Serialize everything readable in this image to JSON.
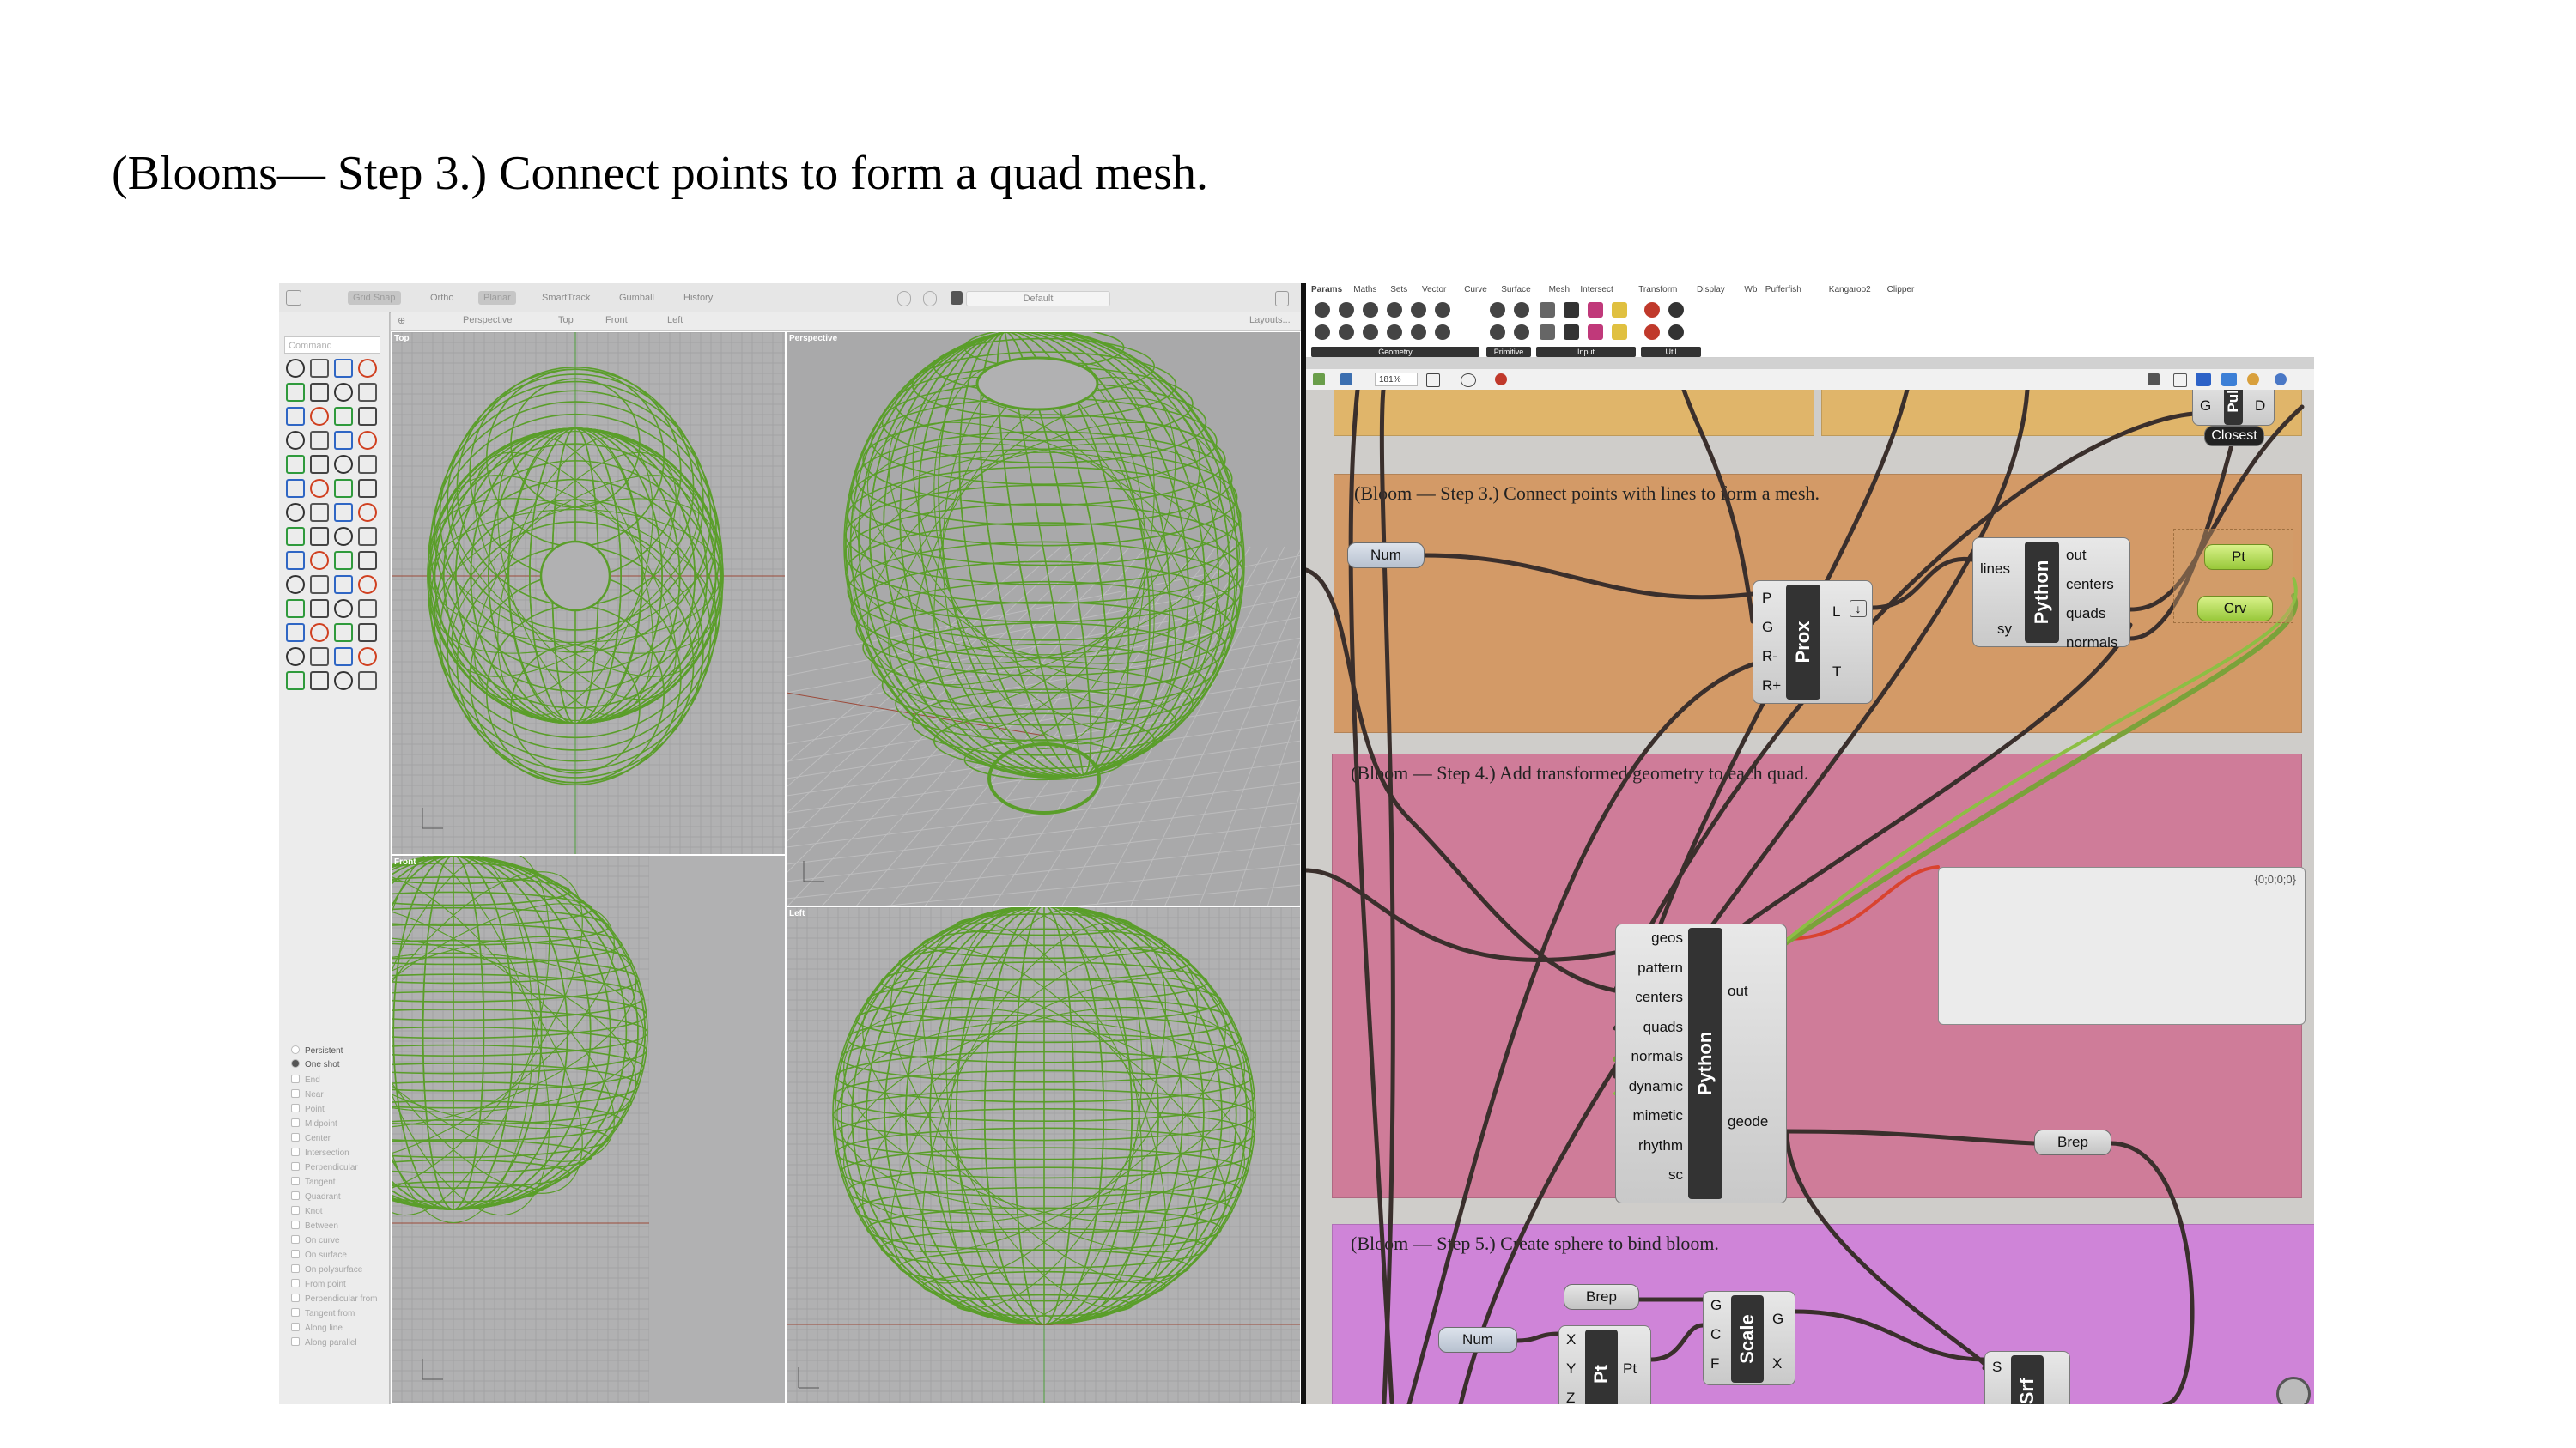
{
  "slide": {
    "title": "(Blooms— Step 3.) Connect points to form a quad mesh."
  },
  "rhino": {
    "toolbar": [
      "Grid Snap",
      "Ortho",
      "Planar",
      "SmartTrack",
      "Gumball",
      "History"
    ],
    "toolbar_right": "Default",
    "view_tabs": [
      "Perspective",
      "Top",
      "Front",
      "Left"
    ],
    "layouts_label": "Layouts...",
    "command_placeholder": "Command",
    "viewports": {
      "top": "Top",
      "perspective": "Perspective",
      "front": "Front",
      "left": "Left"
    },
    "osnap_modes": {
      "persistent": "Persistent",
      "one_shot": "One shot"
    },
    "osnaps": [
      "End",
      "Near",
      "Point",
      "Midpoint",
      "Center",
      "Intersection",
      "Perpendicular",
      "Tangent",
      "Quadrant",
      "Knot",
      "Between",
      "On curve",
      "On surface",
      "On polysurface",
      "From point",
      "Perpendicular from",
      "Tangent from",
      "Along line",
      "Along parallel"
    ],
    "mesh_color": "#5a9e2a"
  },
  "grasshopper": {
    "tabs": [
      "Params",
      "Maths",
      "Sets",
      "Vector",
      "Curve",
      "Surface",
      "Mesh",
      "Intersect",
      "Transform",
      "Display",
      "Wb",
      "Pufferfish",
      "Kangaroo2",
      "Clipper"
    ],
    "ribbon_groups": [
      "Geometry",
      "Primitive",
      "Input",
      "Util"
    ],
    "zoom": "181%",
    "groups": {
      "step3": "(Bloom — Step 3.) Connect points with lines to form a mesh.",
      "step4": "(Bloom — Step 4.) Add transformed geometry to each quad.",
      "step5": "(Bloom — Step 5.) Create sphere to bind bloom."
    },
    "closest": {
      "label": "Closest",
      "bar": "Pull",
      "inputs": [
        "G"
      ],
      "outputs": [
        "D"
      ]
    },
    "num1": "Num",
    "prox": {
      "bar": "Prox",
      "inputs": [
        "P",
        "G",
        "R-",
        "R+"
      ],
      "outputs": [
        "L",
        "T"
      ]
    },
    "python1": {
      "bar": "Python",
      "inputs": [
        "lines",
        "sy"
      ],
      "outputs": [
        "out",
        "centers",
        "quads",
        "normals"
      ]
    },
    "pt": "Pt",
    "crv": "Crv",
    "python2": {
      "bar": "Python",
      "inputs": [
        "geos",
        "pattern",
        "centers",
        "quads",
        "normals",
        "dynamic",
        "mimetic",
        "rhythm",
        "sc"
      ],
      "outputs": [
        "out",
        "geode"
      ]
    },
    "panel_header": "{0;0;0;0}",
    "brep1": "Brep",
    "brep2": "Brep",
    "num2": "Num",
    "pt_comp": {
      "bar": "Pt",
      "inputs": [
        "X",
        "Y",
        "Z"
      ],
      "outputs": [
        "Pt"
      ]
    },
    "scale": {
      "bar": "Scale",
      "inputs": [
        "G",
        "C",
        "F"
      ],
      "outputs": [
        "G",
        "X"
      ]
    },
    "srf": {
      "bar": "Srf",
      "inputs": [
        "S"
      ]
    },
    "group_colors": {
      "step2": "#e0b56a",
      "step3": "#d39a67",
      "step4": "#cf7c99",
      "step5": "#cf84d8"
    }
  }
}
